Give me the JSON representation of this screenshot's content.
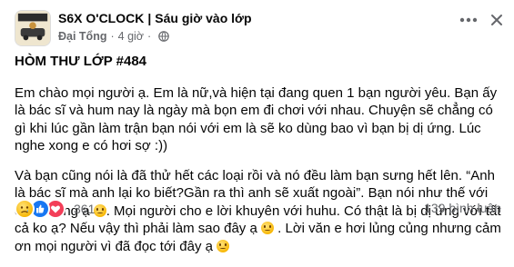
{
  "post": {
    "group_name": "S6X O'CLOCK",
    "separator": "|",
    "subgroup_name": "Sáu giờ vào lớp",
    "author": "Đại Tổng",
    "dot": "·",
    "time": "4 giờ",
    "privacy_icon": "globe-icon",
    "title": "HÒM THƯ LỚP #484",
    "para1": "Em chào mọi người ạ. Em là nữ,và hiện tại đang quen 1 bạn người yêu. Bạn ấy là bác sĩ và hum nay là ngày mà bọn em đi chơi với nhau. Chuyện sẽ chẳng có gì khi lúc gần làm trận bạn nói với em là sẽ ko dùng bao vì bạn bị dị ứng. Lúc nghe xong e có hơi sợ :))",
    "para2_a": "Và bạn cũng nói là đã thử hết các loại rồi và nó đều làm bạn sưng hết lên. “Anh là bác sĩ mà anh lại ko biết?Gần ra thì anh sẽ xuất ngoài”. Bạn nói như thế với em mọi ng ạ ",
    "para2_b": ". Mọi người cho e lời khuyên với huhu. Có thật là bị dị ứng với tất cả ko ạ? Nếu vậy thì phải làm sao đây ạ ",
    "para2_c": " . Lời văn e hơi lủng củng nhưng cảm ơn mọi người vì đã đọc tới đây ạ ",
    "emoji_name": "sad-face-emoji"
  },
  "footer": {
    "reaction_count": "361",
    "comment_count": "139 bình luận",
    "reactions": [
      "sad-reaction-icon",
      "like-reaction-icon",
      "love-reaction-icon"
    ]
  },
  "colors": {
    "text": "#050505",
    "secondary": "#65676b",
    "like": "#1877f2",
    "love": "#f33e58"
  }
}
